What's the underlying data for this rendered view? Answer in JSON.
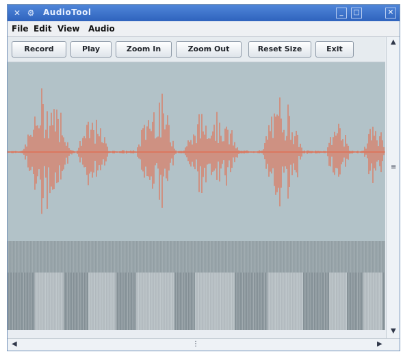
{
  "window": {
    "title": "AudioTool"
  },
  "menu": [
    "File",
    "Edit",
    "View",
    "Audio"
  ],
  "toolbar": {
    "record": "Record",
    "play": "Play",
    "zoom_in": "Zoom In",
    "zoom_out": "Zoom Out",
    "reset_size": "Reset Size",
    "exit": "Exit"
  },
  "colors": {
    "waveform": "#e9603d",
    "waveform_bg": "#b2c2c8",
    "title_bar": "#3a6fcc"
  },
  "icons": {
    "app": "app-icon",
    "close": "close-icon",
    "minimize": "minimize-icon",
    "maximize": "maximize-icon"
  }
}
